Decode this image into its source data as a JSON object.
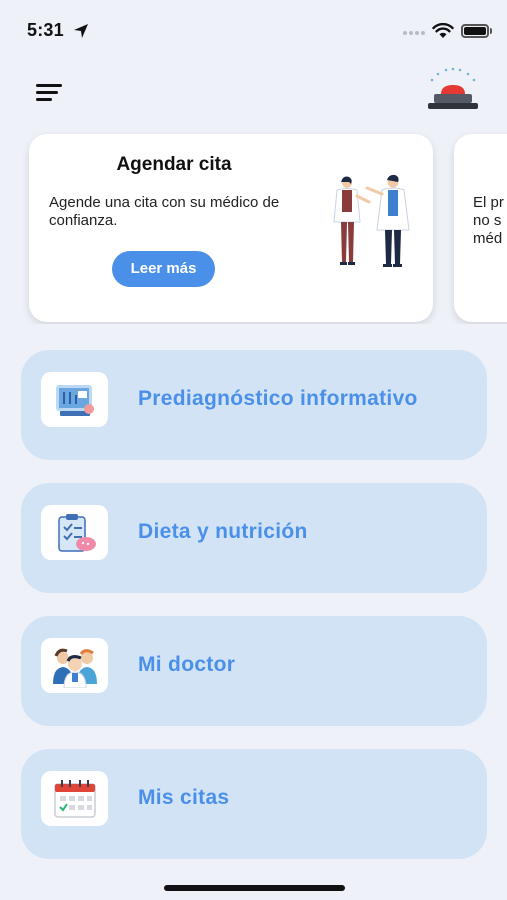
{
  "status_bar": {
    "time": "5:31"
  },
  "carousel": {
    "cards": [
      {
        "title": "Agendar cita",
        "text": "Agende una cita con su médico de confianza.",
        "button_label": "Leer más"
      },
      {
        "text_lines": [
          "El pr",
          "no s",
          "méd"
        ]
      }
    ]
  },
  "menu": {
    "items": [
      {
        "label": "Prediagnóstico informativo",
        "icon": "prediagnosis-icon"
      },
      {
        "label": "Dieta y nutrición",
        "icon": "diet-clipboard-icon"
      },
      {
        "label": "Mi doctor",
        "icon": "doctors-icon"
      },
      {
        "label": "Mis citas",
        "icon": "calendar-icon"
      }
    ]
  },
  "colors": {
    "accent": "#4a90e8",
    "item_background": "#d3e3f6",
    "page_background": "#eef2f8",
    "emergency": "#e53935"
  }
}
